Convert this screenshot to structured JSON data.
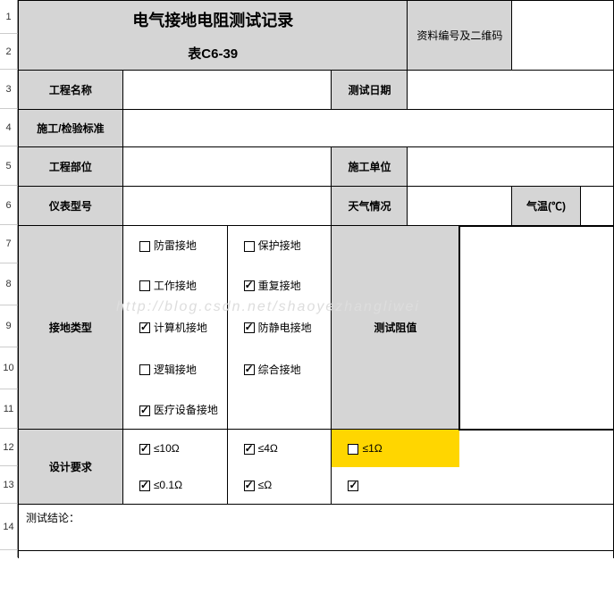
{
  "title": "电气接地电阻测试记录",
  "subtitle": "表C6-39",
  "qr_label": "资料编号及二维码",
  "labels": {
    "project_name": "工程名称",
    "test_date": "测试日期",
    "std": "施工/检验标准",
    "project_part": "工程部位",
    "construct_unit": "施工单位",
    "instrument_model": "仪表型号",
    "weather": "天气情况",
    "temperature": "气温(℃)",
    "ground_type": "接地类型",
    "test_value": "测试阻值",
    "design_req": "设计要求",
    "conclusion": "测试结论："
  },
  "ground_types": [
    [
      {
        "label": "防雷接地",
        "checked": false
      },
      {
        "label": "保护接地",
        "checked": false
      }
    ],
    [
      {
        "label": "工作接地",
        "checked": false
      },
      {
        "label": "重复接地",
        "checked": true
      }
    ],
    [
      {
        "label": "计算机接地",
        "checked": true
      },
      {
        "label": "防静电接地",
        "checked": true
      }
    ],
    [
      {
        "label": "逻辑接地",
        "checked": false
      },
      {
        "label": "综合接地",
        "checked": true
      }
    ],
    [
      {
        "label": "医疗设备接地",
        "checked": true
      }
    ]
  ],
  "design_reqs": [
    [
      {
        "label": "≤10Ω",
        "checked": true,
        "hl": false
      },
      {
        "label": "≤4Ω",
        "checked": true,
        "hl": false
      },
      {
        "label": "≤1Ω",
        "checked": false,
        "hl": true
      }
    ],
    [
      {
        "label": "≤0.1Ω",
        "checked": true,
        "hl": false
      },
      {
        "label": "≤Ω",
        "checked": true,
        "hl": false
      },
      {
        "label": "",
        "checked": true,
        "hl": false
      }
    ]
  ],
  "watermark": "http://blog.csdn.net/shaoyezhangliwei"
}
